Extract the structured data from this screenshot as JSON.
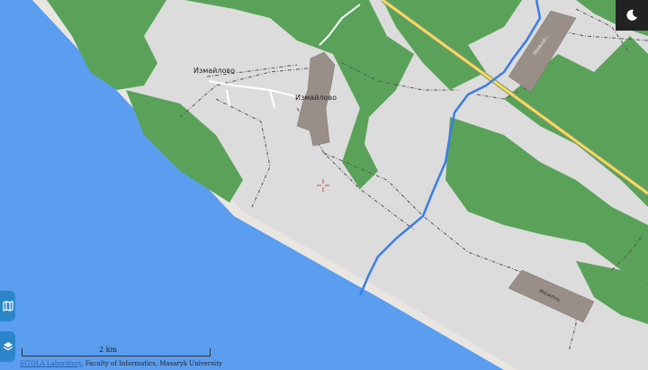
{
  "map": {
    "places": [
      {
        "name": "Измайлово"
      },
      {
        "name": "Измайлово"
      }
    ],
    "building_labels": [
      {
        "text": "Нижне..."
      },
      {
        "text": "Межень"
      }
    ],
    "colors": {
      "water": "#5b9ef0",
      "forest": "#5aa25a",
      "land": "#dcdcdc",
      "building": "#9a8f88",
      "river": "#3b7de8",
      "highway": "#f0e050",
      "track": "#555555"
    }
  },
  "controls": {
    "layers_icon": "layers-icon",
    "map_icon": "map-icon",
    "moon_icon": "moon-icon"
  },
  "scale": {
    "label": "2 km"
  },
  "attribution": {
    "link": "SITOLA Laboratory",
    "text": ", Faculty of Informatics, Masaryk University"
  }
}
